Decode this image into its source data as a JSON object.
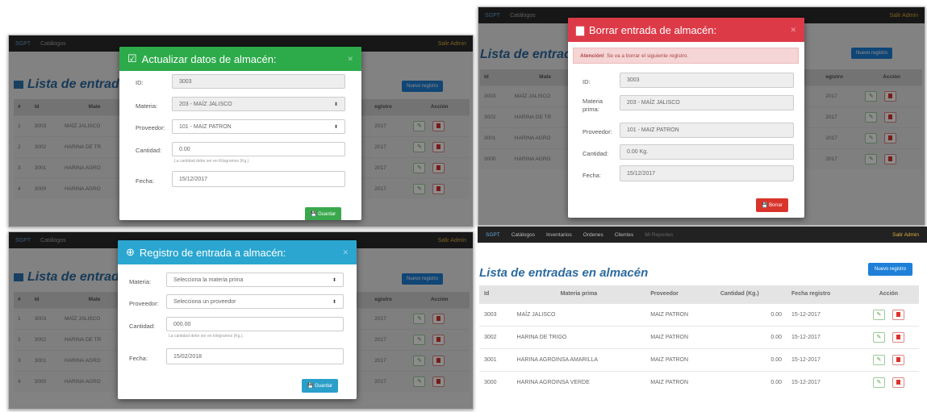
{
  "nav": {
    "brand": "SGPT",
    "catalogos": "Catálogos",
    "inventarios": "Inventarios",
    "ordenes": "Ordenes",
    "clientes": "Clientes",
    "reportes": "Mi Reportes",
    "salir": "Salir Admin"
  },
  "page": {
    "title_short": "Lista de entrad",
    "title_full": "Lista de entradas en almacén",
    "new_button": "Nuevo registro"
  },
  "table": {
    "headers": {
      "id": "Id",
      "materia": "Materia prima",
      "materia_short": "Mate",
      "proveedor": "Proveedor",
      "cantidad": "Cantidad (Kg.)",
      "fecha": "Fecha registro",
      "fecha_short": "egistro",
      "accion": "Acción"
    },
    "rows": [
      {
        "n": "1",
        "id": "3003",
        "materia": "MAÍZ JALISCO",
        "materia_short": "MAÍZ JALISCO",
        "materia_short2": "MAÍZ JALISCO",
        "proveedor": "MAIZ PATRON",
        "cantidad": "0.00",
        "fecha": "15-12-2017",
        "fecha_short": "2017"
      },
      {
        "n": "2",
        "id": "3002",
        "materia": "HARINA DE TRIGO",
        "materia_short": "HARINA DE TR",
        "materia_short2": "HARINA DE TR",
        "proveedor": "MAIZ PATRON",
        "cantidad": "0.00",
        "fecha": "15-12-2017",
        "fecha_short": "2017"
      },
      {
        "n": "3",
        "id": "3001",
        "materia": "HARINA AGROINSA AMARILLA",
        "materia_short": "HARINA AGRO",
        "materia_short2": "HARINA AGRO",
        "proveedor": "MAIZ PATRON",
        "cantidad": "0.00",
        "fecha": "15-12-2017",
        "fecha_short": "2017"
      },
      {
        "n": "4",
        "id": "3000",
        "materia": "HARINA AGROINSA VERDE",
        "materia_short": "HARINA AGRO",
        "materia_short2": "HARINA AGRO",
        "proveedor": "MAIZ PATRON",
        "cantidad": "0.00",
        "fecha": "15-12-2017",
        "fecha_short": "2017"
      }
    ]
  },
  "update_modal": {
    "title": "Actualizar datos de almacén:",
    "id_label": "ID:",
    "id_value": "3003",
    "materia_label": "Materia:",
    "materia_value": "203 - MAÍZ JALISCO",
    "proveedor_label": "Proveedor:",
    "proveedor_value": "101 - MAIZ PATRON",
    "cantidad_label": "Cantidad:",
    "cantidad_value": "0.00",
    "cantidad_help": "La cantidad debe ser en Kilogramos (Kg.).",
    "fecha_label": "Fecha:",
    "fecha_value": "15/12/2017",
    "save": "Guardar"
  },
  "delete_modal": {
    "title": "Borrar entrada de almacén:",
    "alert_bold": "Atención!",
    "alert_text": "Se va a borrar el siguiente registro.",
    "id_label": "ID:",
    "id_value": "3003",
    "materia_label": "Materia prima:",
    "materia_value": "203 - MAÍZ JALISCO",
    "proveedor_label": "Proveedor:",
    "proveedor_value": "101 - MAIZ PATRON",
    "cantidad_label": "Cantidad:",
    "cantidad_value": "0.00 Kg.",
    "fecha_label": "Fecha:",
    "fecha_value": "15/12/2017",
    "delete": "Borrar"
  },
  "new_modal": {
    "title": "Registro de entrada a almacén:",
    "materia_label": "Materia:",
    "materia_placeholder": "Selecciona la materia prima",
    "proveedor_label": "Proveedor:",
    "proveedor_placeholder": "Selecciona un proveedor",
    "cantidad_label": "Cantidad:",
    "cantidad_placeholder": "000.00",
    "cantidad_help": "La cantidad debe ser en kilogramos (Kg.).",
    "fecha_label": "Fecha:",
    "fecha_value": "15/02/2018",
    "save": "Guardar"
  },
  "colors": {
    "update": "#2daa4a",
    "delete": "#dd3a48",
    "new": "#2aa6d0",
    "save_green": "#3aa84c",
    "save_blue": "#2a9fc9",
    "delete_btn": "#d9342b"
  }
}
